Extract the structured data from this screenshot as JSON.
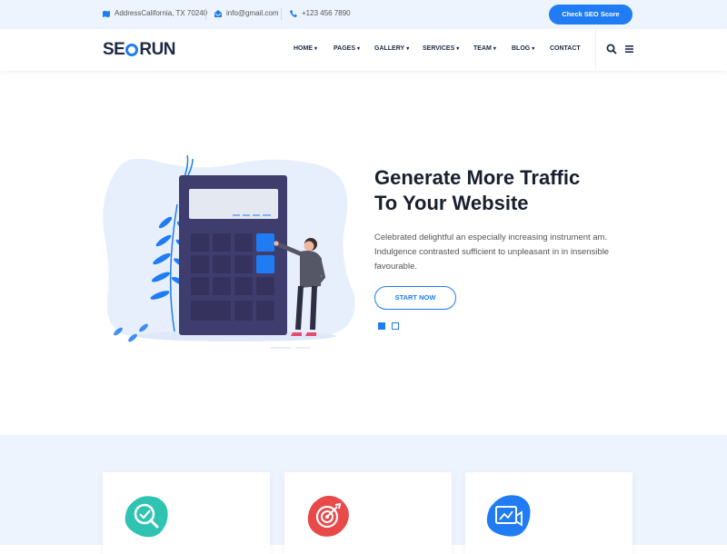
{
  "topbar": {
    "address": "AddressCalifornia, TX 70240",
    "email": "info@gmail.com",
    "phone": "+123 456 7890",
    "cta": "Check SEO Score"
  },
  "logo": {
    "left": "SE",
    "right": "RUN"
  },
  "nav": {
    "items": [
      {
        "label": "HOME",
        "dropdown": true
      },
      {
        "label": "PAGES",
        "dropdown": true
      },
      {
        "label": "GALLERY",
        "dropdown": true
      },
      {
        "label": "SERVICES",
        "dropdown": true
      },
      {
        "label": "TEAM",
        "dropdown": true
      },
      {
        "label": "BLOG",
        "dropdown": true
      },
      {
        "label": "CONTACT",
        "dropdown": false
      }
    ],
    "chevron": "▾"
  },
  "hero": {
    "title_line1": "Generate More Traffic",
    "title_line2": "To Your Website",
    "text": "Celebrated delightful an especially increasing instrument am. Indulgence contrasted sufficient to unpleasant in in insensible favourable.",
    "button": "START NOW"
  },
  "colors": {
    "accent": "#1f7cf2",
    "dark": "#1e2a44",
    "light_bg": "#eef4fd",
    "teal": "#2fc4b2",
    "red": "#e84a4a"
  },
  "cards": [
    {
      "icon": "seo-analysis-icon"
    },
    {
      "icon": "target-icon"
    },
    {
      "icon": "marketing-icon"
    }
  ]
}
